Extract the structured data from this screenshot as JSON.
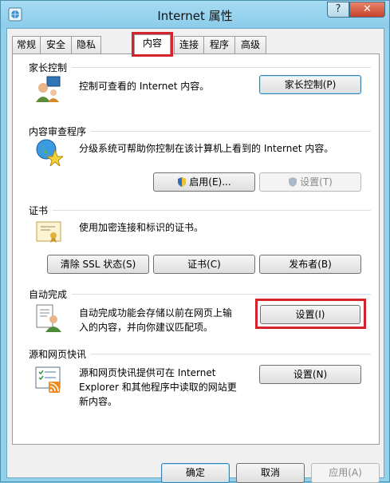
{
  "window": {
    "title": "Internet 属性",
    "help_label": "?",
    "close_label": "✕"
  },
  "tabs": [
    {
      "label": "常规"
    },
    {
      "label": "安全"
    },
    {
      "label": "隐私"
    },
    {
      "label": "内容",
      "active": true
    },
    {
      "label": "连接"
    },
    {
      "label": "程序"
    },
    {
      "label": "高级"
    }
  ],
  "parental": {
    "title": "家长控制",
    "desc": "控制可查看的 Internet 内容。",
    "button": "家长控制(P)",
    "icon": "parental-control-icon"
  },
  "advisor": {
    "title": "内容审查程序",
    "desc": "分级系统可帮助你控制在该计算机上看到的 Internet 内容。",
    "enable_button": "启用(E)...",
    "settings_button": "设置(T)",
    "icon": "globe-star-icon"
  },
  "certificates": {
    "title": "证书",
    "desc": "使用加密连接和标识的证书。",
    "clear_ssl_button": "清除 SSL 状态(S)",
    "certificates_button": "证书(C)",
    "publishers_button": "发布者(B)",
    "icon": "certificate-icon"
  },
  "autocomplete": {
    "title": "自动完成",
    "desc_line1": "自动完成功能会存储以前在网页上输",
    "desc_line2": "入的内容，并向你建议匹配项。",
    "settings_button": "设置(I)",
    "icon": "autocomplete-icon"
  },
  "feeds": {
    "title": "源和网页快讯",
    "desc_line1": "源和网页快讯提供可在 Internet",
    "desc_line2": "Explorer 和其他程序中读取的网站更",
    "desc_line3": "新内容。",
    "settings_button": "设置(N)",
    "icon": "feeds-icon"
  },
  "footer": {
    "ok": "确定",
    "cancel": "取消",
    "apply": "应用(A)"
  },
  "colors": {
    "highlight": "#d4232a",
    "frame": "#93d0ea"
  }
}
